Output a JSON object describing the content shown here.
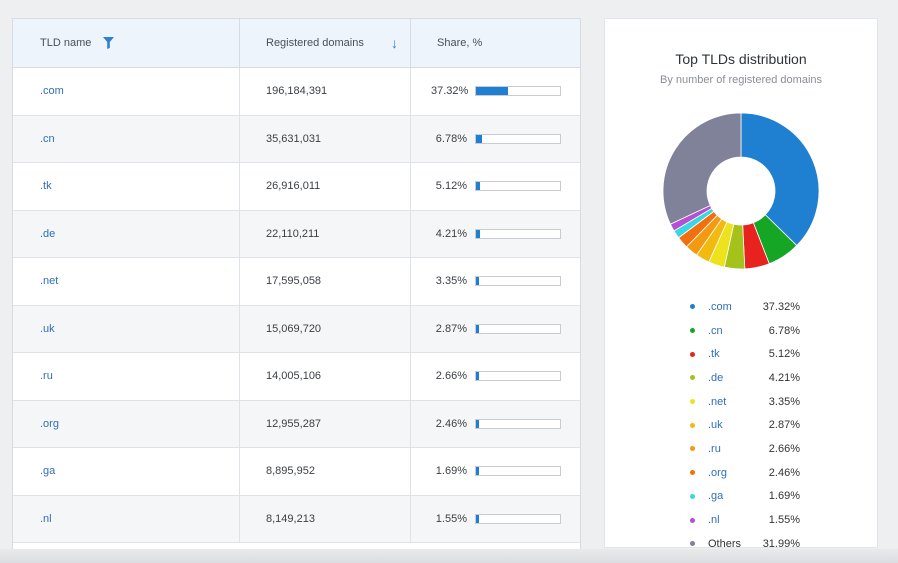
{
  "table": {
    "headers": {
      "tld": "TLD name",
      "registered": "Registered domains",
      "share": "Share, %"
    },
    "rows": [
      {
        "tld": ".com",
        "registered": "196,184,391",
        "share": "37.32%",
        "share_value": 37.32
      },
      {
        "tld": ".cn",
        "registered": "35,631,031",
        "share": "6.78%",
        "share_value": 6.78
      },
      {
        "tld": ".tk",
        "registered": "26,916,011",
        "share": "5.12%",
        "share_value": 5.12
      },
      {
        "tld": ".de",
        "registered": "22,110,211",
        "share": "4.21%",
        "share_value": 4.21
      },
      {
        "tld": ".net",
        "registered": "17,595,058",
        "share": "3.35%",
        "share_value": 3.35
      },
      {
        "tld": ".uk",
        "registered": "15,069,720",
        "share": "2.87%",
        "share_value": 2.87
      },
      {
        "tld": ".ru",
        "registered": "14,005,106",
        "share": "2.66%",
        "share_value": 2.66
      },
      {
        "tld": ".org",
        "registered": "12,955,287",
        "share": "2.46%",
        "share_value": 2.46
      },
      {
        "tld": ".ga",
        "registered": "8,895,952",
        "share": "1.69%",
        "share_value": 1.69
      },
      {
        "tld": ".nl",
        "registered": "8,149,213",
        "share": "1.55%",
        "share_value": 1.55
      }
    ],
    "bar_color": "#1f7fd0"
  },
  "chart": {
    "title": "Top TLDs distribution",
    "subtitle": "By number of registered domains"
  },
  "chart_data": {
    "type": "pie",
    "variant": "donut",
    "title": "Top TLDs distribution",
    "subtitle": "By number of registered domains",
    "legend_placement": "bottom",
    "categories": [
      ".com",
      ".cn",
      ".tk",
      ".de",
      ".net",
      ".uk",
      ".ru",
      ".org",
      ".ga",
      ".nl",
      "Others"
    ],
    "values": [
      37.32,
      6.78,
      5.12,
      4.21,
      3.35,
      2.87,
      2.66,
      2.46,
      1.69,
      1.55,
      31.99
    ],
    "labels": [
      "37.32%",
      "6.78%",
      "5.12%",
      "4.21%",
      "3.35%",
      "2.87%",
      "2.66%",
      "2.46%",
      "1.69%",
      "1.55%",
      "31.99%"
    ],
    "colors": [
      "#1f7fd0",
      "#15a626",
      "#e8231f",
      "#a4c21a",
      "#eee21c",
      "#f2b90f",
      "#f49a12",
      "#f0700e",
      "#37d7e6",
      "#b44fd6",
      "#7f8299"
    ]
  }
}
